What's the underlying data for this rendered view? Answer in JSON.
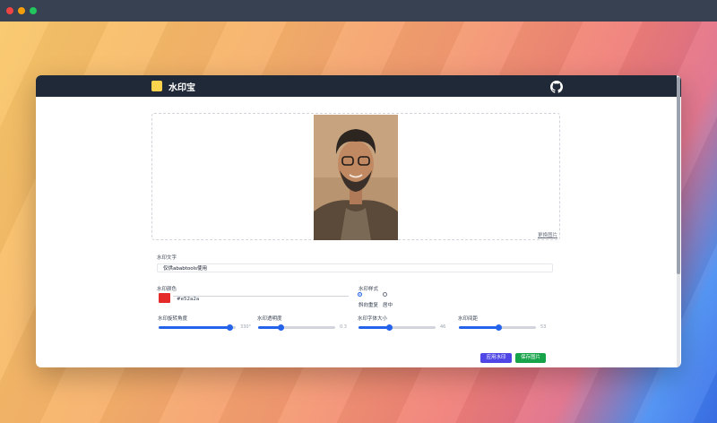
{
  "app": {
    "title": "水印宝",
    "github_icon": "github-icon"
  },
  "upload": {
    "change_image_label": "更换图片"
  },
  "form": {
    "watermark_text_label": "水印文字",
    "watermark_text_value": "仅供ababtools使用",
    "color_label": "水印颜色",
    "color_value": "#e52a2a",
    "style_label": "水印样式",
    "style_options": [
      "斜向重复",
      "居中"
    ],
    "style_selected": "斜向重复",
    "sliders": [
      {
        "label": "水印旋转角度",
        "value_text": "330°",
        "fraction": 0.93
      },
      {
        "label": "水印透明度",
        "value_text": "0.3",
        "fraction": 0.3
      },
      {
        "label": "水印字体大小",
        "value_text": "46",
        "fraction": 0.4
      },
      {
        "label": "水印间距",
        "value_text": "53",
        "fraction": 0.52
      }
    ],
    "apply_button": "应用水印",
    "save_button": "保存图片"
  }
}
